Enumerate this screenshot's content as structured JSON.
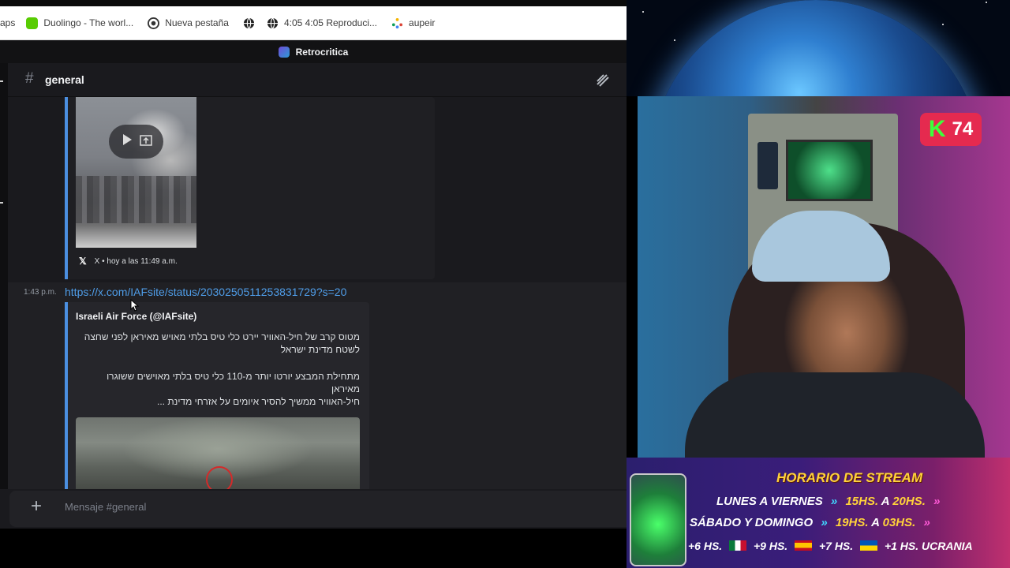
{
  "browser": {
    "bookmarks": [
      {
        "label": "aps",
        "icon": "partial-icon"
      },
      {
        "label": "Duolingo - The worl...",
        "icon": "duolingo-icon"
      },
      {
        "label": "Nueva pestaña",
        "icon": "chrome-icon"
      },
      {
        "label": "",
        "icon": "globe-icon"
      },
      {
        "label": "4:05 4:05 Reproduci...",
        "icon": "globe-icon"
      },
      {
        "label": "aupeir",
        "icon": "sparkle-icon"
      }
    ]
  },
  "discord": {
    "server_name": "Retrocritica",
    "channel_name": "general",
    "embed1": {
      "source": "X",
      "footer": "hoy a las 11:49 a.m."
    },
    "message": {
      "timestamp": "1:43 p.m.",
      "link": "https://x.com/IAFsite/status/2030250511253831729?s=20",
      "embed_author": "Israeli Air Force (@IAFsite)",
      "embed_lines": [
        "מטוס קרב של חיל-האוויר יירט כלי טיס בלתי מאויש מאיראן לפני שחצה לשטח מדינת ישראל",
        "מתחילת המבצע יורטו יותר מ-110 כלי טיס בלתי מאוישים ששוגרו מאיראן",
        "חיל-האוויר ממשיך להסיר איומים על אזרחי מדינת ..."
      ]
    },
    "composer": {
      "placeholder": "Mensaje #general"
    }
  },
  "overlay": {
    "badge_number": "74",
    "badge_letter": "K",
    "schedule": {
      "title": "HORARIO DE STREAM",
      "rows": [
        {
          "days": "LUNES A VIERNES",
          "from": "15HS.",
          "sep": "A",
          "to": "20HS."
        },
        {
          "days": "SÁBADO Y DOMINGO",
          "from": "19HS.",
          "sep": "A",
          "to": "03HS."
        }
      ],
      "timezones": [
        {
          "offset": "+6 HS.",
          "flag": "none"
        },
        {
          "offset": "+9 HS.",
          "flag": "mexico"
        },
        {
          "offset": "+7 HS.",
          "flag": "spain"
        },
        {
          "offset": "+1 HS. UCRANIA",
          "flag": "ukraine"
        }
      ]
    }
  },
  "colors": {
    "discord_bg": "#1a1a1e",
    "link": "#4f9de8",
    "embed_border": "#4b8fe0",
    "badge": "#e52a4f",
    "schedule_gold": "#ffd23a"
  }
}
